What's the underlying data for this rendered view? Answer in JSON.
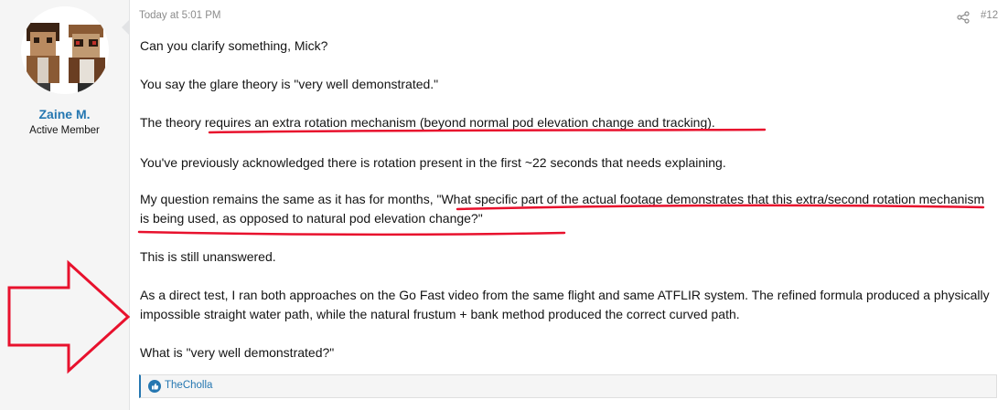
{
  "user": {
    "name": "Zaine M.",
    "title": "Active Member",
    "avatar_icon": "pixel-avatar-icon"
  },
  "post": {
    "timestamp": "Today at 5:01 PM",
    "number": "#12",
    "paragraphs": [
      "Can you clarify something, Mick?",
      "You say the glare theory is \"very well demonstrated.\"",
      "The theory requires an extra rotation mechanism (beyond normal pod elevation change and tracking).",
      "You've previously acknowledged there is rotation present in the first ~22 seconds that needs explaining.",
      "My question remains the same as it has for months, \"What specific part of the actual footage demonstrates that this extra/second rotation mechanism is being used, as opposed to natural pod elevation change?\"",
      "This is still unanswered.",
      "As a direct test, I ran both approaches on the Go Fast video from the same flight and same ATFLIR system. The refined formula produced a physically impossible straight water path, while the natural frustum + bank method produced the correct curved path.",
      "What is \"very well demonstrated?\""
    ]
  },
  "reactions": {
    "icon": "like-icon",
    "users": "TheCholla"
  },
  "colors": {
    "link": "#2577b1",
    "annotation": "#e8112d",
    "muted": "#8c8c8c"
  }
}
